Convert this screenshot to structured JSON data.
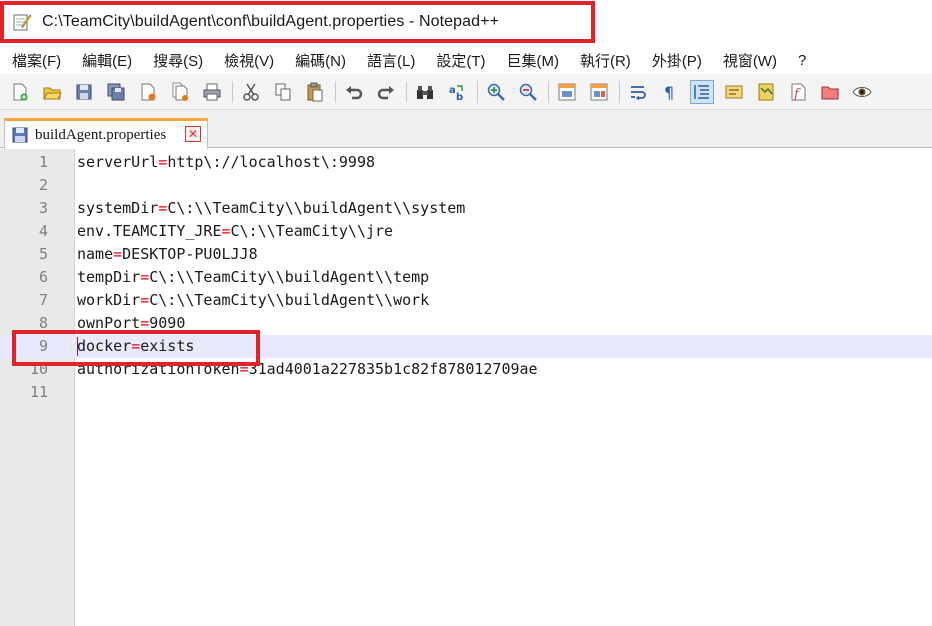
{
  "window": {
    "title": "C:\\TeamCity\\buildAgent\\conf\\buildAgent.properties - Notepad++"
  },
  "menu": [
    "檔案(F)",
    "編輯(E)",
    "搜尋(S)",
    "檢視(V)",
    "編碼(N)",
    "語言(L)",
    "設定(T)",
    "巨集(M)",
    "執行(R)",
    "外掛(P)",
    "視窗(W)",
    "?"
  ],
  "tab": {
    "label": "buildAgent.properties"
  },
  "editor": {
    "lines": [
      {
        "num": "1",
        "key": "serverUrl",
        "value": "http\\://localhost\\:9998"
      },
      {
        "num": "2",
        "key": "",
        "value": ""
      },
      {
        "num": "3",
        "key": "systemDir",
        "value": "C\\:\\\\TeamCity\\\\buildAgent\\\\system"
      },
      {
        "num": "4",
        "key": "env.TEAMCITY_JRE",
        "value": "C\\:\\\\TeamCity\\\\jre"
      },
      {
        "num": "5",
        "key": "name",
        "value": "DESKTOP-PU0LJJ8"
      },
      {
        "num": "6",
        "key": "tempDir",
        "value": "C\\:\\\\TeamCity\\\\buildAgent\\\\temp"
      },
      {
        "num": "7",
        "key": "workDir",
        "value": "C\\:\\\\TeamCity\\\\buildAgent\\\\work"
      },
      {
        "num": "8",
        "key": "ownPort",
        "value": "9090"
      },
      {
        "num": "9",
        "key": "docker",
        "value": "exists"
      },
      {
        "num": "10",
        "key": "authorizationToken",
        "value": "31ad4001a227835b1c82f878012709ae"
      },
      {
        "num": "11",
        "key": "",
        "value": ""
      }
    ],
    "current_line": 9
  },
  "colors": {
    "highlight_box": "#e4222a",
    "operator": "#e0001b",
    "current_line_bg": "#e8e8ff",
    "tab_accent": "#f5a53a"
  }
}
